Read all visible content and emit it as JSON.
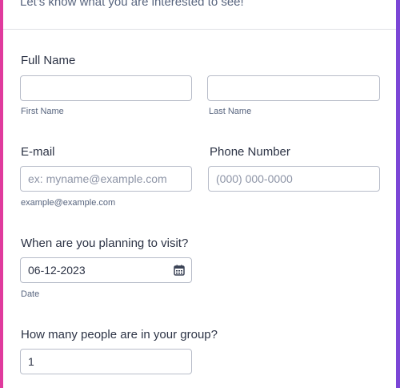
{
  "form": {
    "subtitle": "Let's know what you are interested to see!",
    "full_name": {
      "label": "Full Name",
      "first": {
        "value": "",
        "sublabel": "First Name"
      },
      "last": {
        "value": "",
        "sublabel": "Last Name"
      }
    },
    "email": {
      "label": "E-mail",
      "placeholder": "ex: myname@example.com",
      "sublabel": "example@example.com"
    },
    "phone": {
      "label": "Phone Number",
      "placeholder": "(000) 000-0000"
    },
    "visit": {
      "label": "When are you planning to visit?",
      "value": "06-12-2023",
      "sublabel": "Date",
      "icon": "calendar-icon"
    },
    "group": {
      "label": "How many people are in your group?",
      "value": "1"
    }
  },
  "colors": {
    "left_accent": "#e03a9d",
    "right_accent": "#7b46d6",
    "text": "#2c3345",
    "muted": "#57647e",
    "border": "#b8bdc9"
  }
}
